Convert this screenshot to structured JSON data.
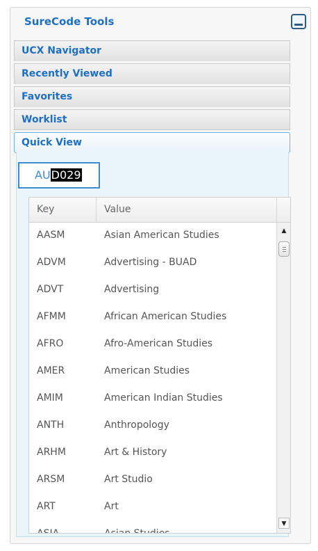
{
  "panel": {
    "title": "SureCode Tools",
    "collapse_icon": "minus-box-icon"
  },
  "accordion": [
    {
      "label": "UCX Navigator"
    },
    {
      "label": "Recently Viewed"
    },
    {
      "label": "Favorites"
    },
    {
      "label": "Worklist"
    },
    {
      "label": "Quick View"
    }
  ],
  "quick_view": {
    "input_prefix": "AU",
    "input_selected": "D029",
    "grid": {
      "headers": {
        "key": "Key",
        "value": "Value"
      },
      "rows": [
        {
          "key": "AASM",
          "value": "Asian American Studies"
        },
        {
          "key": "ADVM",
          "value": "Advertising - BUAD"
        },
        {
          "key": "ADVT",
          "value": "Advertising"
        },
        {
          "key": "AFMM",
          "value": "African American Studies"
        },
        {
          "key": "AFRO",
          "value": "Afro-American Studies"
        },
        {
          "key": "AMER",
          "value": "American Studies"
        },
        {
          "key": "AMIM",
          "value": "American Indian Studies"
        },
        {
          "key": "ANTH",
          "value": "Anthropology"
        },
        {
          "key": "ARHM",
          "value": "Art & History"
        },
        {
          "key": "ARSM",
          "value": "Art Studio"
        },
        {
          "key": "ART",
          "value": "Art"
        },
        {
          "key": "ASIA",
          "value": "Asian Studies"
        }
      ],
      "scroll_up_glyph": "▲",
      "scroll_down_glyph": "▼"
    }
  }
}
